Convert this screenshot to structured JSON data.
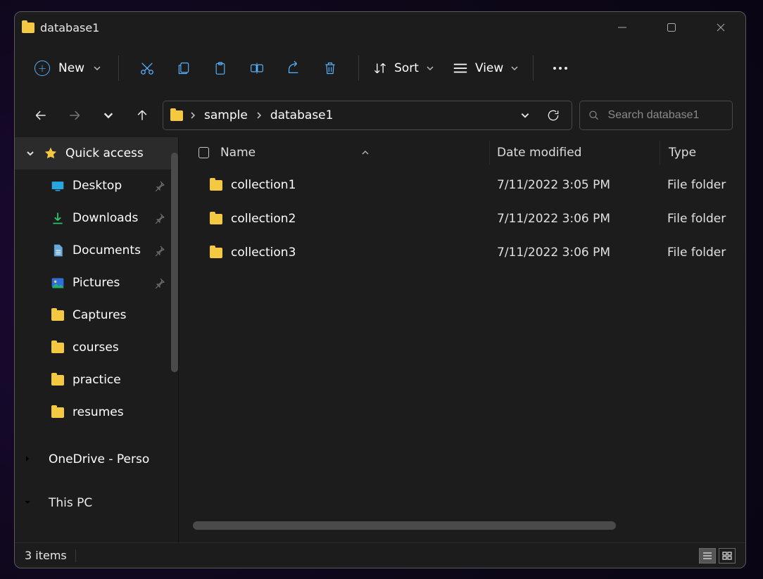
{
  "window": {
    "title": "database1"
  },
  "toolbar": {
    "new_label": "New",
    "sort_label": "Sort",
    "view_label": "View"
  },
  "breadcrumbs": [
    "sample",
    "database1"
  ],
  "search": {
    "placeholder": "Search database1"
  },
  "sidebar": {
    "quick_access": "Quick access",
    "items": [
      {
        "label": "Desktop",
        "icon": "desktop",
        "pinned": true
      },
      {
        "label": "Downloads",
        "icon": "download",
        "pinned": true
      },
      {
        "label": "Documents",
        "icon": "document",
        "pinned": true
      },
      {
        "label": "Pictures",
        "icon": "pictures",
        "pinned": true
      },
      {
        "label": "Captures",
        "icon": "folder",
        "pinned": false
      },
      {
        "label": "courses",
        "icon": "folder",
        "pinned": false
      },
      {
        "label": "practice",
        "icon": "folder",
        "pinned": false
      },
      {
        "label": "resumes",
        "icon": "folder",
        "pinned": false
      }
    ],
    "onedrive": "OneDrive - Perso",
    "thispc": "This PC"
  },
  "columns": {
    "name": "Name",
    "modified": "Date modified",
    "type": "Type"
  },
  "files": [
    {
      "name": "collection1",
      "modified": "7/11/2022 3:05 PM",
      "type": "File folder"
    },
    {
      "name": "collection2",
      "modified": "7/11/2022 3:06 PM",
      "type": "File folder"
    },
    {
      "name": "collection3",
      "modified": "7/11/2022 3:06 PM",
      "type": "File folder"
    }
  ],
  "footer": {
    "status": "3 items"
  }
}
